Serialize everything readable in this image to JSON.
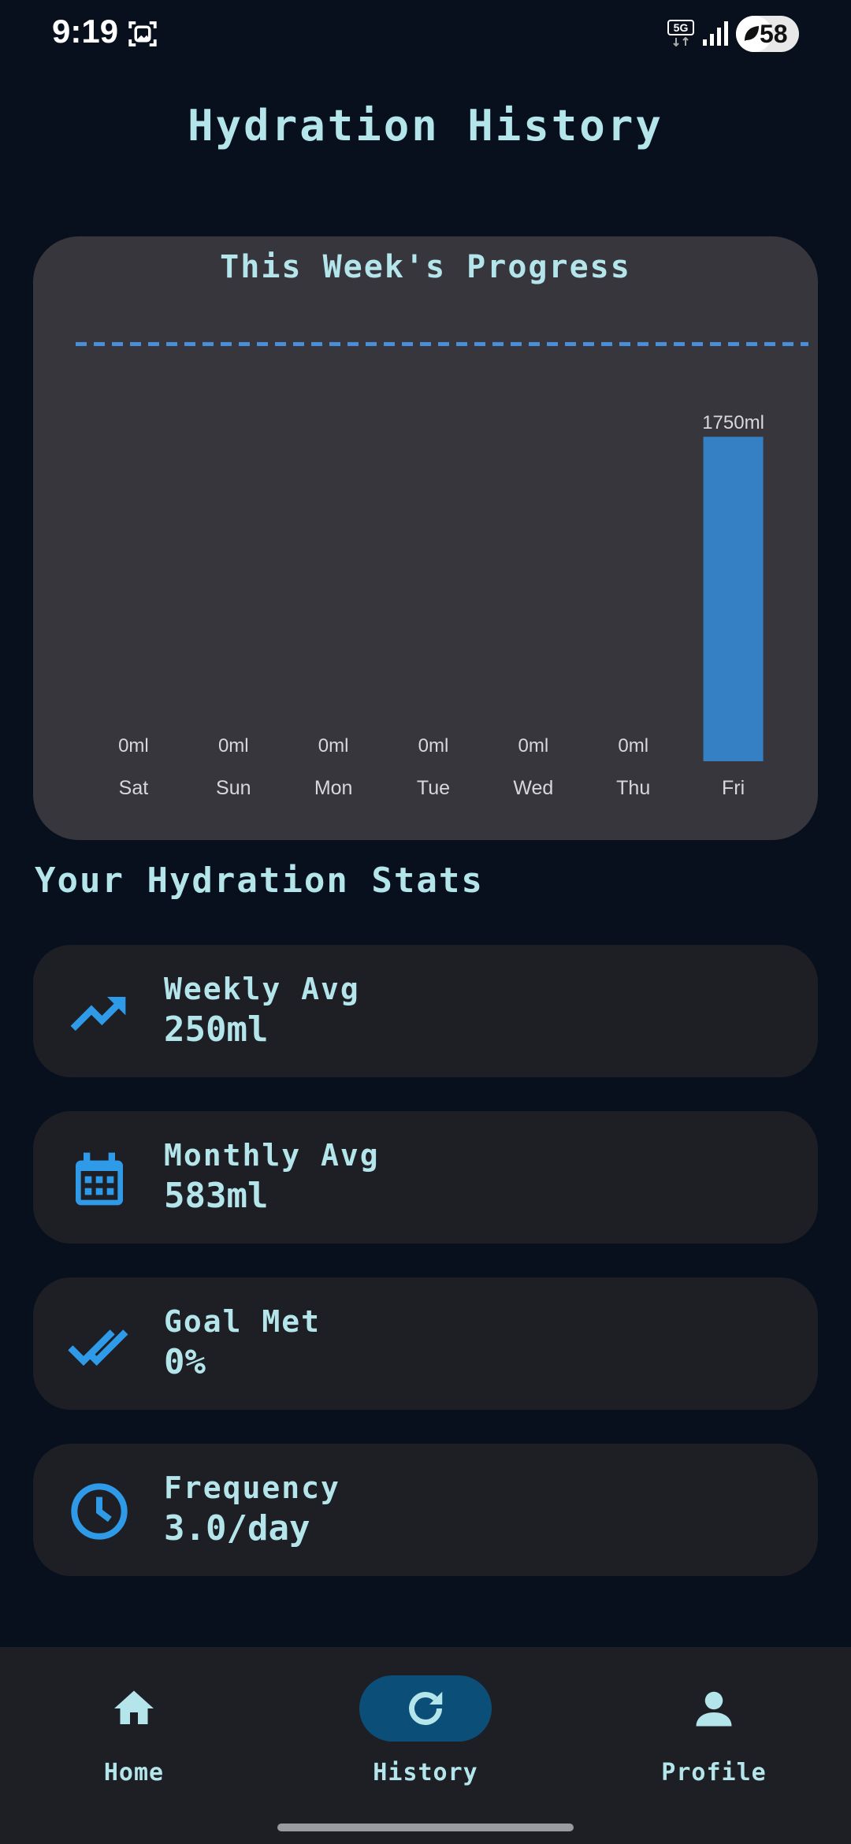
{
  "status_bar": {
    "time": "9:19",
    "network": "5G",
    "battery": "58",
    "battery_level": 0.58
  },
  "page": {
    "title": "Hydration History"
  },
  "chart_card": {
    "title": "This Week's Progress"
  },
  "chart_data": {
    "type": "bar",
    "categories": [
      "Sat",
      "Sun",
      "Mon",
      "Tue",
      "Wed",
      "Thu",
      "Fri"
    ],
    "values": [
      0,
      0,
      0,
      0,
      0,
      0,
      1750
    ],
    "value_labels": [
      "0ml",
      "0ml",
      "0ml",
      "0ml",
      "0ml",
      "0ml",
      "1750ml"
    ],
    "unit": "ml",
    "goal_line": 2250,
    "ylim": [
      0,
      2550
    ],
    "bar_color": "#3580c4",
    "goal_line_color": "#4a90d9",
    "grid": false
  },
  "stats": {
    "section_title": "Your Hydration Stats",
    "items": [
      {
        "label": "Weekly Avg",
        "value": "250ml",
        "icon": "trending-up-icon"
      },
      {
        "label": "Monthly Avg",
        "value": "583ml",
        "icon": "calendar-icon"
      },
      {
        "label": "Goal Met",
        "value": "0%",
        "icon": "double-check-icon"
      },
      {
        "label": "Frequency",
        "value": "3.0/day",
        "icon": "clock-icon"
      }
    ]
  },
  "nav": {
    "items": [
      {
        "label": "Home",
        "icon": "home-icon",
        "active": false
      },
      {
        "label": "History",
        "icon": "history-icon",
        "active": true
      },
      {
        "label": "Profile",
        "icon": "profile-icon",
        "active": false
      }
    ]
  },
  "colors": {
    "background": "#08101d",
    "card": "#37363d",
    "stat_card": "#1e1e25",
    "accent": "#2f9be8",
    "text": "#b3e5ea",
    "active_pill": "#0b4f78"
  }
}
